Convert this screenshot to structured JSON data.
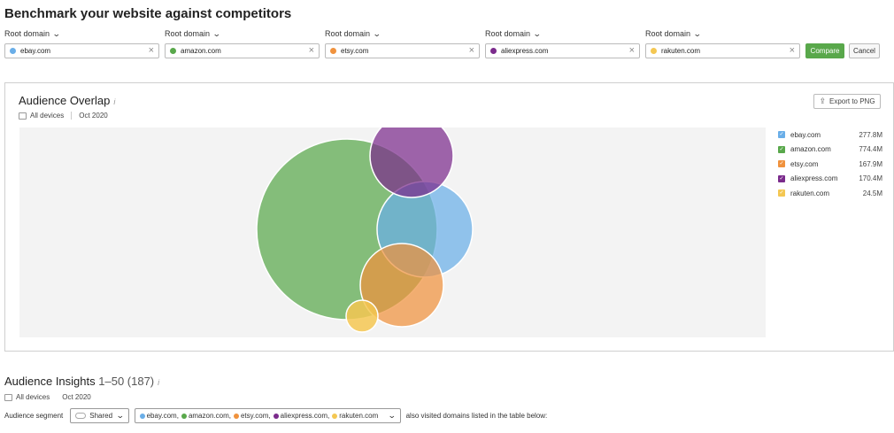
{
  "page": {
    "title": "Benchmark your website against competitors"
  },
  "domain_label": "Root domain",
  "domains": [
    {
      "name": "ebay.com",
      "color": "#6aaee8"
    },
    {
      "name": "amazon.com",
      "color": "#59a84b"
    },
    {
      "name": "etsy.com",
      "color": "#f0923d"
    },
    {
      "name": "aliexpress.com",
      "color": "#7b2b8c"
    },
    {
      "name": "rakuten.com",
      "color": "#f4c752"
    }
  ],
  "buttons": {
    "compare": "Compare",
    "cancel": "Cancel",
    "export": "Export to PNG"
  },
  "overlap": {
    "title": "Audience Overlap",
    "device": "All devices",
    "date": "Oct 2020",
    "legend": [
      {
        "name": "ebay.com",
        "value": "277.8M",
        "color": "#6aaee8"
      },
      {
        "name": "amazon.com",
        "value": "774.4M",
        "color": "#59a84b"
      },
      {
        "name": "etsy.com",
        "value": "167.9M",
        "color": "#f0923d"
      },
      {
        "name": "aliexpress.com",
        "value": "170.4M",
        "color": "#7b2b8c"
      },
      {
        "name": "rakuten.com",
        "value": "24.5M",
        "color": "#f4c752"
      }
    ]
  },
  "insights": {
    "title": "Audience Insights",
    "range": "1–50 (187)",
    "device": "All devices",
    "date": "Oct 2020",
    "segment_label": "Audience segment",
    "segment_value": "Shared",
    "domains_list": [
      "ebay.com",
      "amazon.com",
      "etsy.com",
      "aliexpress.com",
      "rakuten.com"
    ],
    "suffix": "also visited domains listed in the table below:"
  }
}
